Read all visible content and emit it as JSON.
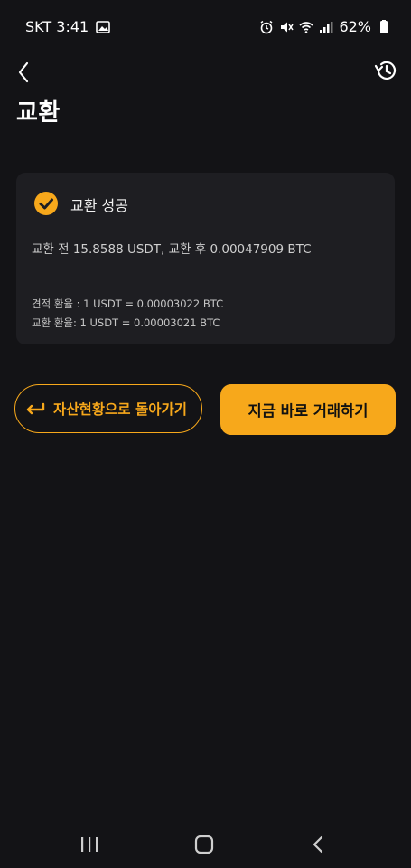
{
  "status_bar": {
    "carrier_time": "SKT 3:41",
    "battery": "62%"
  },
  "header": {
    "title": "교환"
  },
  "result_card": {
    "status": "교환 성공",
    "summary": "교환 전 15.8588 USDT, 교환 후 0.00047909 BTC",
    "estimated_rate": "견적 환율 : 1 USDT = 0.00003022 BTC",
    "exchange_rate": "교환 환율: 1 USDT = 0.00003021 BTC"
  },
  "actions": {
    "back_to_assets": "자산현황으로 돌아가기",
    "trade_now": "지금 바로 거래하기"
  },
  "colors": {
    "background": "#131316",
    "card": "#1e1e22",
    "accent": "#f7a81b"
  }
}
